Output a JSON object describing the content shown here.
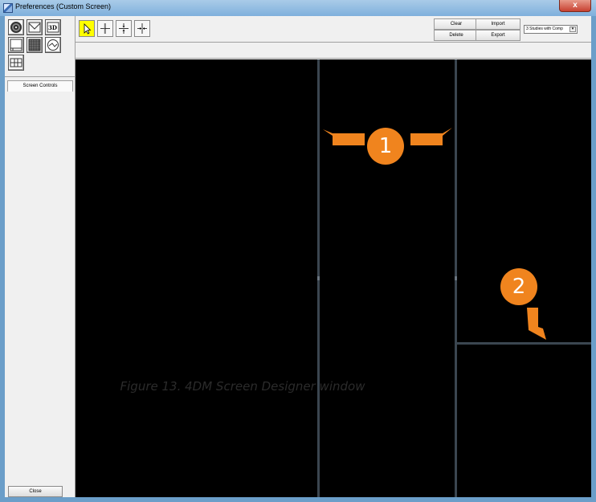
{
  "window": {
    "title": "Preferences (Custom Screen)",
    "close_glyph": "x"
  },
  "left_panel": {
    "icons": [
      "polar-map-icon",
      "curve-icon",
      "3d-icon",
      "slice-panel-icon",
      "grid-icon",
      "dial-icon",
      "multi-panel-icon"
    ],
    "three_d_label": "3D",
    "tab_label": "Screen Controls",
    "close_label": "Close"
  },
  "toolbar": {
    "tools": [
      "pointer-tool-icon",
      "cross-split-icon",
      "horizontal-split-icon",
      "vertical-split-icon"
    ],
    "clear_label": "Clear",
    "delete_label": "Delete",
    "import_label": "Import",
    "export_label": "Export",
    "studies_select_value": "3 Studies with Comp"
  },
  "caption": "Figure 13.  4DM Screen Designer window",
  "callouts": [
    "1",
    "2"
  ],
  "colors": {
    "canvas": "#000000",
    "divider": "#3b4650",
    "callout": "#f0841e",
    "active_tool": "#ffff00"
  }
}
